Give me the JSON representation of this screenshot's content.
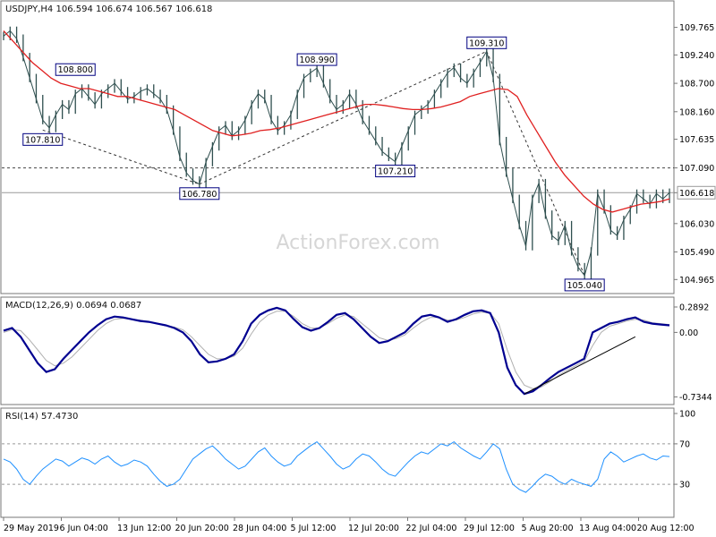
{
  "chart_data": [
    {
      "type": "line",
      "symbol": "USDJPY",
      "timeframe": "H4",
      "title": "USDJPY,H4  106.594 106.674 106.567 106.618",
      "watermark": "ActionForex.com",
      "ylim": [
        104.8,
        110.15
      ],
      "yticks": [
        "109.765",
        "109.240",
        "108.700",
        "108.160",
        "107.635",
        "107.090",
        "106.618",
        "106.030",
        "105.490",
        "104.965"
      ],
      "xticks": [
        "29 May 2019",
        "6 Jun 04:00",
        "13 Jun 12:00",
        "20 Jun 20:00",
        "28 Jun 04:00",
        "5 Jul 12:00",
        "12 Jul 20:00",
        "22 Jul 04:00",
        "29 Jul 12:00",
        "5 Aug 20:00",
        "13 Aug 04:00",
        "20 Aug 12:00"
      ],
      "price_series": [
        109.6,
        109.7,
        109.55,
        109.2,
        108.8,
        108.4,
        108.0,
        107.85,
        108.1,
        108.3,
        108.2,
        108.5,
        108.6,
        108.45,
        108.3,
        108.5,
        108.6,
        108.7,
        108.55,
        108.4,
        108.45,
        108.55,
        108.6,
        108.5,
        108.4,
        108.2,
        107.8,
        107.3,
        107.0,
        106.85,
        106.78,
        107.2,
        107.5,
        107.8,
        107.9,
        107.7,
        107.8,
        108.0,
        108.3,
        108.5,
        108.4,
        108.0,
        107.8,
        107.9,
        108.1,
        108.5,
        108.8,
        108.9,
        108.99,
        108.7,
        108.4,
        108.2,
        108.3,
        108.5,
        108.3,
        108.0,
        107.8,
        107.6,
        107.4,
        107.3,
        107.21,
        107.5,
        107.8,
        108.1,
        108.2,
        108.3,
        108.5,
        108.7,
        108.9,
        109.0,
        108.8,
        108.7,
        108.9,
        109.1,
        109.31,
        108.8,
        107.6,
        107.0,
        106.5,
        106.0,
        105.6,
        106.5,
        106.8,
        106.2,
        105.8,
        105.7,
        106.0,
        105.5,
        105.2,
        105.04,
        105.5,
        106.6,
        106.3,
        105.9,
        105.8,
        106.1,
        106.3,
        106.6,
        106.5,
        106.4,
        106.6,
        106.5,
        106.618
      ],
      "ma_series": [
        109.7,
        109.5,
        109.3,
        109.1,
        108.95,
        108.8,
        108.7,
        108.65,
        108.6,
        108.6,
        108.55,
        108.5,
        108.45,
        108.45,
        108.4,
        108.35,
        108.3,
        108.25,
        108.2,
        108.1,
        108.0,
        107.9,
        107.8,
        107.75,
        107.7,
        107.72,
        107.75,
        107.8,
        107.82,
        107.85,
        107.9,
        107.95,
        108.0,
        108.05,
        108.1,
        108.15,
        108.2,
        108.25,
        108.3,
        108.3,
        108.28,
        108.25,
        108.22,
        108.2,
        108.2,
        108.22,
        108.25,
        108.3,
        108.35,
        108.45,
        108.5,
        108.55,
        108.6,
        108.58,
        108.45,
        108.1,
        107.8,
        107.5,
        107.2,
        106.95,
        106.75,
        106.55,
        106.4,
        106.3,
        106.25,
        106.3,
        106.35,
        106.4,
        106.42,
        106.45,
        106.5
      ],
      "hlines": [
        {
          "label": "107.090",
          "value": 107.09,
          "style": "dashed"
        },
        {
          "label": "106.618",
          "value": 106.618,
          "style": "solid"
        }
      ],
      "annotations": [
        {
          "label": "108.800",
          "x_index": 11,
          "value": 108.8
        },
        {
          "label": "107.810",
          "x_index": 6,
          "value": 107.81
        },
        {
          "label": "106.780",
          "x_index": 30,
          "value": 106.78
        },
        {
          "label": "108.990",
          "x_index": 48,
          "value": 108.99
        },
        {
          "label": "107.210",
          "x_index": 60,
          "value": 107.21
        },
        {
          "label": "109.310",
          "x_index": 74,
          "value": 109.31
        },
        {
          "label": "105.040",
          "x_index": 89,
          "value": 105.04
        }
      ]
    },
    {
      "type": "line",
      "title": "MACD(12,26,9) 0.0694 0.0687",
      "ylim": [
        -0.78,
        0.34
      ],
      "yticks": [
        "0.2892",
        "0.00",
        "-0.7344"
      ],
      "macd_series": [
        0.02,
        0.05,
        -0.05,
        -0.2,
        -0.35,
        -0.45,
        -0.42,
        -0.3,
        -0.2,
        -0.1,
        0.0,
        0.08,
        0.15,
        0.18,
        0.17,
        0.15,
        0.13,
        0.12,
        0.1,
        0.08,
        0.05,
        0.0,
        -0.1,
        -0.25,
        -0.34,
        -0.33,
        -0.3,
        -0.25,
        -0.1,
        0.1,
        0.2,
        0.25,
        0.28,
        0.25,
        0.15,
        0.06,
        0.02,
        0.05,
        0.12,
        0.2,
        0.22,
        0.15,
        0.05,
        -0.05,
        -0.12,
        -0.1,
        -0.05,
        0.0,
        0.1,
        0.18,
        0.2,
        0.17,
        0.12,
        0.15,
        0.2,
        0.24,
        0.25,
        0.22,
        0.0,
        -0.4,
        -0.6,
        -0.7,
        -0.67,
        -0.6,
        -0.52,
        -0.45,
        -0.4,
        -0.35,
        -0.3,
        0.0,
        0.05,
        0.1,
        0.12,
        0.15,
        0.17,
        0.12,
        0.1,
        0.09,
        0.08
      ],
      "signal_series": [
        0.0,
        0.03,
        0.02,
        -0.08,
        -0.2,
        -0.32,
        -0.38,
        -0.35,
        -0.28,
        -0.18,
        -0.08,
        0.02,
        0.1,
        0.15,
        0.16,
        0.15,
        0.14,
        0.12,
        0.1,
        0.08,
        0.06,
        0.03,
        -0.05,
        -0.15,
        -0.25,
        -0.3,
        -0.3,
        -0.27,
        -0.18,
        -0.02,
        0.12,
        0.2,
        0.24,
        0.24,
        0.18,
        0.1,
        0.05,
        0.05,
        0.1,
        0.16,
        0.2,
        0.18,
        0.1,
        0.02,
        -0.06,
        -0.09,
        -0.07,
        -0.03,
        0.05,
        0.12,
        0.17,
        0.17,
        0.14,
        0.14,
        0.17,
        0.21,
        0.23,
        0.22,
        0.1,
        -0.2,
        -0.45,
        -0.6,
        -0.64,
        -0.62,
        -0.56,
        -0.49,
        -0.43,
        -0.38,
        -0.33,
        -0.15,
        0.0,
        0.07,
        0.1,
        0.13,
        0.15,
        0.14,
        0.11,
        0.1,
        0.09
      ]
    },
    {
      "type": "line",
      "title": "RSI(14) 57.4730",
      "ylim": [
        0,
        100
      ],
      "yticks": [
        "100",
        "70",
        "30",
        "0"
      ],
      "levels": [
        70,
        30
      ],
      "rsi_series": [
        55,
        52,
        45,
        35,
        30,
        38,
        45,
        50,
        55,
        53,
        48,
        52,
        56,
        54,
        50,
        55,
        58,
        52,
        48,
        50,
        54,
        52,
        48,
        40,
        33,
        28,
        30,
        35,
        45,
        55,
        60,
        65,
        68,
        62,
        55,
        50,
        45,
        48,
        55,
        62,
        66,
        58,
        52,
        48,
        50,
        58,
        63,
        68,
        72,
        65,
        58,
        50,
        45,
        48,
        55,
        60,
        58,
        52,
        45,
        40,
        38,
        45,
        52,
        58,
        62,
        60,
        65,
        70,
        68,
        72,
        66,
        62,
        58,
        55,
        62,
        70,
        65,
        45,
        30,
        25,
        22,
        28,
        35,
        40,
        38,
        33,
        30,
        35,
        32,
        30,
        28,
        35,
        55,
        62,
        58,
        52,
        55,
        58,
        60,
        56,
        54,
        58,
        57.473
      ],
      "x_labels_shared": true
    }
  ]
}
